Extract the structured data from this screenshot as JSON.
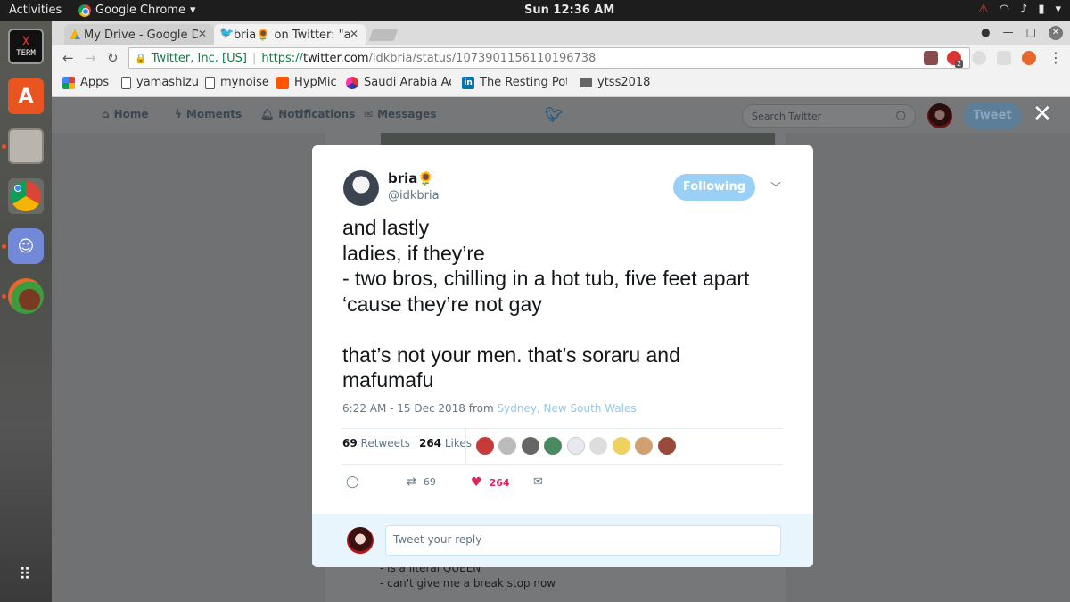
{
  "system": {
    "activities": "Activities",
    "app_menu": "Google Chrome",
    "clock": "Sun 12:36 AM"
  },
  "browser": {
    "tabs": [
      {
        "label": "My Drive - Google D"
      },
      {
        "label": "bria🌻 on Twitter: \"a"
      }
    ],
    "url": {
      "secure_label": "Twitter, Inc. [US]",
      "scheme": "https://",
      "domain": "twitter.com",
      "path": "/idkbria/status/1073901156110196738"
    },
    "bookmarks": [
      {
        "label": "Apps"
      },
      {
        "label": "yamashizu"
      },
      {
        "label": "mynoise"
      },
      {
        "label": "HypMic"
      },
      {
        "label": "Saudi Arabia Ack"
      },
      {
        "label": "The Resting Pote"
      },
      {
        "label": "ytss2018"
      }
    ],
    "extension_badge": "2"
  },
  "twitter_nav": {
    "home": "Home",
    "moments": "Moments",
    "notifications": "Notifications",
    "messages": "Messages",
    "search_placeholder": "Search Twitter",
    "tweet_button": "Tweet"
  },
  "background_tweet": {
    "line1": "- is a literal QUEEN",
    "line2": "- can't give me a break stop now"
  },
  "tweet": {
    "author_name": "bria🌻",
    "author_handle": "@idkbria",
    "follow_label": "Following",
    "text": "and lastly\nladies, if they’re\n- two bros, chilling in a hot tub, five feet apart\n‘cause they’re not gay\n\nthat’s not your men. that’s soraru and\nmafumafu",
    "time": "6:22 AM - 15 Dec 2018 from ",
    "location": "Sydney, New South Wales",
    "retweets_count": "69",
    "retweets_label": "Retweets",
    "likes_count": "264",
    "likes_label": "Likes",
    "action_retweets": "69",
    "action_likes": "264",
    "reply_placeholder": "Tweet your reply"
  },
  "colors": {
    "twitter_blue": "#1da1f2",
    "like_red": "#e0245e",
    "ubuntu_orange": "#e95420"
  }
}
